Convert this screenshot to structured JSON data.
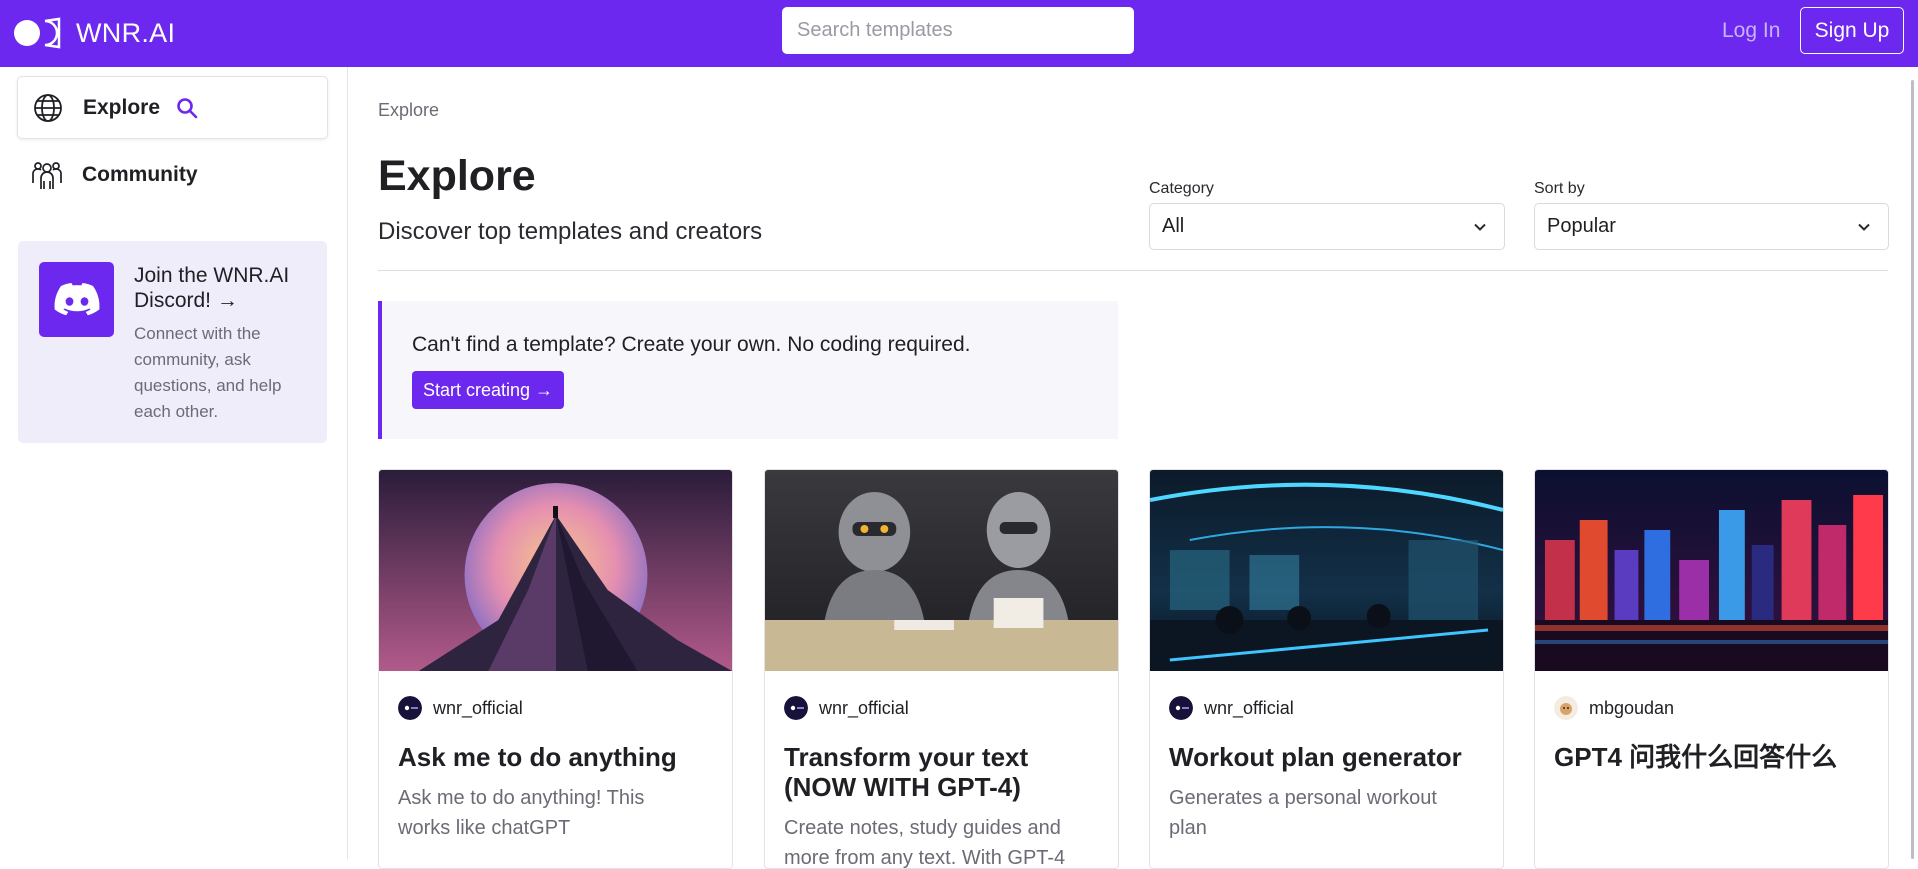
{
  "app": {
    "name": "WNR.AI"
  },
  "header": {
    "search_placeholder": "Search templates",
    "login_label": "Log In",
    "signup_label": "Sign Up"
  },
  "sidebar": {
    "items": [
      {
        "label": "Explore",
        "icon": "globe-icon",
        "active": true
      },
      {
        "label": "Community",
        "icon": "people-icon",
        "active": false
      }
    ],
    "discord": {
      "title": "Join the WNR.AI Discord! →",
      "description": "Connect with the community, ask questions, and help each other."
    }
  },
  "main": {
    "breadcrumb": "Explore",
    "title": "Explore",
    "subtitle": "Discover top templates and creators",
    "filters": {
      "category": {
        "label": "Category",
        "value": "All"
      },
      "sort": {
        "label": "Sort by",
        "value": "Popular"
      }
    },
    "promo": {
      "text": "Can't find a template? Create your own. No coding required.",
      "button_label": "Start creating →"
    },
    "cards": [
      {
        "author": "wnr_official",
        "title": "Ask me to do anything",
        "description": "Ask me to do anything! This works like chatGPT",
        "image": "mountain-moon-illustration"
      },
      {
        "author": "wnr_official",
        "title": "Transform your text (NOW WITH GPT-4)",
        "description": "Create notes, study guides and more from any text. With GPT-4",
        "image": "robots-reading-illustration"
      },
      {
        "author": "wnr_official",
        "title": "Workout plan generator",
        "description": "Generates a personal workout plan",
        "image": "neon-gym-illustration"
      },
      {
        "author": "mbgoudan",
        "title": "GPT4 问我什么回答什么",
        "description": "",
        "image": "neon-city-illustration"
      }
    ]
  },
  "colors": {
    "brand": "#6d28f0",
    "promo_bg": "#f7f6fb",
    "discord_bg": "#f0edfb"
  }
}
